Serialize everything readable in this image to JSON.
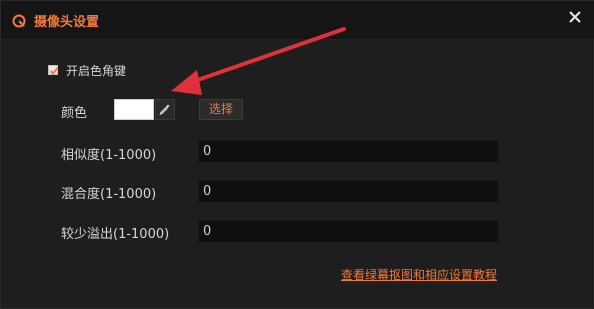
{
  "dialog": {
    "title": "摄像头设置",
    "app_icon": "app-logo-icon",
    "close_icon": "close-icon"
  },
  "chroma_key": {
    "enable_label": "开启色角键",
    "enabled": true
  },
  "color": {
    "label": "颜色",
    "swatch_color": "#ffffff",
    "picker_icon": "eyedropper-icon",
    "select_label": "选择"
  },
  "similarity": {
    "label": "相似度(1-1000)",
    "value": "0"
  },
  "blend": {
    "label": "混合度(1-1000)",
    "value": "0"
  },
  "spill": {
    "label": "较少溢出(1-1000)",
    "value": "0"
  },
  "footer": {
    "tutorial_link": "查看绿幕抠图和相应设置教程"
  },
  "colors": {
    "accent": "#f07a3a",
    "annotation_arrow": "#e0303a"
  }
}
